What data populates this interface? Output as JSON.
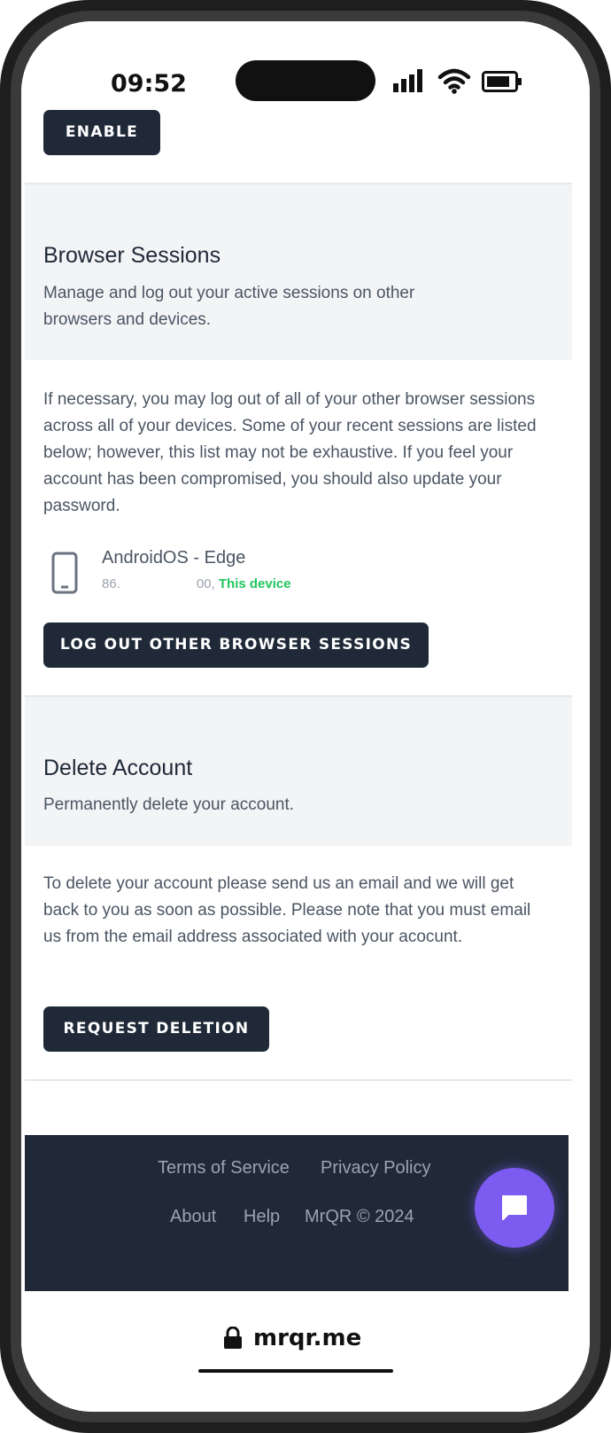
{
  "status": {
    "time": "09:52"
  },
  "two_factor": {
    "enable_label": "ENABLE"
  },
  "browser_sessions": {
    "title": "Browser Sessions",
    "subtitle": "Manage and log out your active sessions on other browsers and devices.",
    "body": "If necessary, you may log out of all of your other browser sessions across all of your devices. Some of your recent sessions are listed below; however, this list may not be exhaustive. If you feel your account has been compromised, you should also update your password.",
    "session": {
      "name": "AndroidOS - Edge",
      "ip_prefix": "86.",
      "ip_suffix": "00,",
      "this_device": "This device"
    },
    "logout_label": "LOG OUT OTHER BROWSER SESSIONS"
  },
  "delete_account": {
    "title": "Delete Account",
    "subtitle": "Permanently delete your account.",
    "body": "To delete your account please send us an email and we will get back to you as soon as possible. Please note that you must email us from the email address associated with your acocunt.",
    "request_label": "REQUEST DELETION"
  },
  "footer": {
    "terms": "Terms of Service",
    "privacy": "Privacy Policy",
    "about": "About",
    "help": "Help",
    "copyright": "MrQR © 2024"
  },
  "browser": {
    "url": "mrqr.me"
  },
  "colors": {
    "primary_button": "#1f2937",
    "accent_green": "#22c55e",
    "chat_purple": "#7c5cf0",
    "section_gray": "#f3f4f6"
  },
  "icons": [
    "signal-icon",
    "wifi-icon",
    "battery-icon",
    "phone-device-icon",
    "chat-icon",
    "lock-icon"
  ]
}
